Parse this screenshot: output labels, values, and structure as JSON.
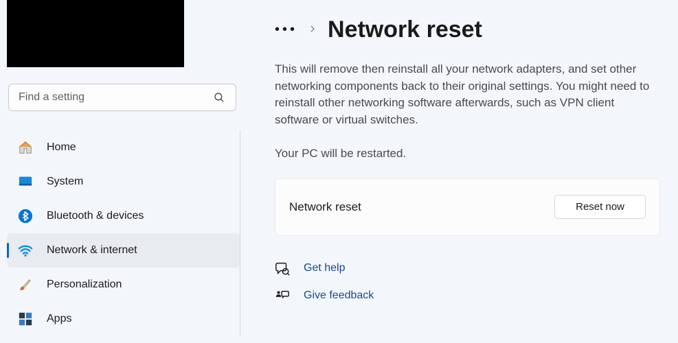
{
  "search": {
    "placeholder": "Find a setting"
  },
  "nav": {
    "home": "Home",
    "system": "System",
    "bluetooth": "Bluetooth & devices",
    "network": "Network & internet",
    "personalization": "Personalization",
    "apps": "Apps"
  },
  "breadcrumb": {
    "title": "Network reset"
  },
  "description": "This will remove then reinstall all your network adapters, and set other networking components back to their original settings. You might need to reinstall other networking software afterwards, such as VPN client software or virtual switches.",
  "restart_note": "Your PC will be restarted.",
  "reset_card": {
    "label": "Network reset",
    "button": "Reset now"
  },
  "links": {
    "get_help": "Get help",
    "give_feedback": "Give feedback"
  }
}
